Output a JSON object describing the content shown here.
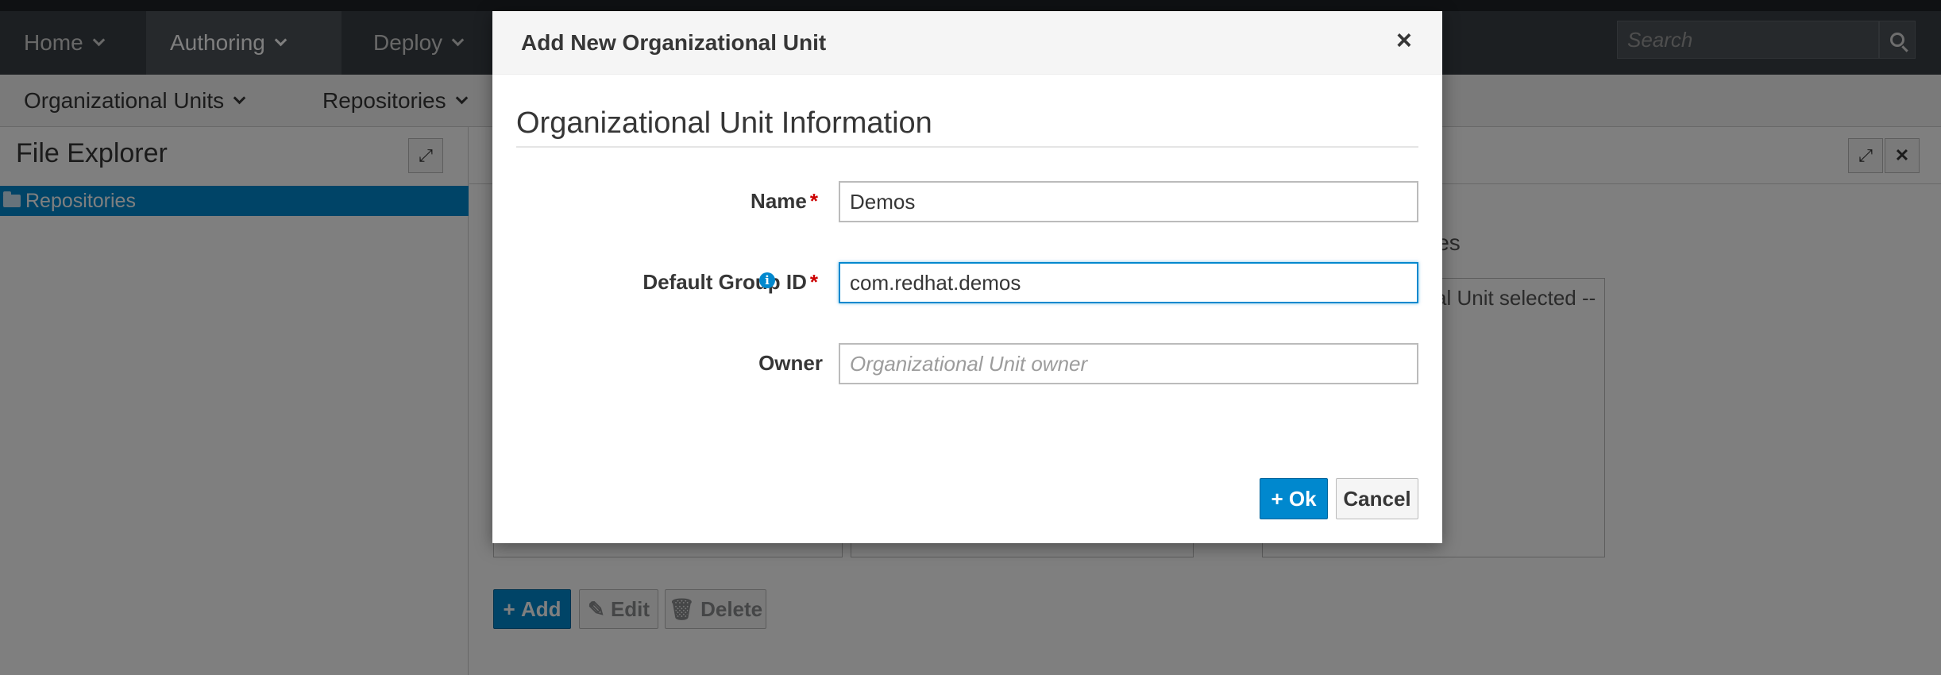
{
  "topnav": {
    "items": [
      {
        "label": "Home",
        "active": false
      },
      {
        "label": "Authoring",
        "active": true
      },
      {
        "label": "Deploy",
        "active": false
      }
    ],
    "search_placeholder": "Search"
  },
  "subnav": {
    "items": [
      {
        "label": "Organizational Units"
      },
      {
        "label": "Repositories"
      }
    ]
  },
  "explorer": {
    "title": "File Explorer",
    "tree_root": "Repositories"
  },
  "background": {
    "repositories_heading_fragment": "ies",
    "no_unit_text_fragment": "al Unit selected --",
    "add_label": "Add",
    "edit_label": "Edit",
    "delete_label": "Delete"
  },
  "modal": {
    "title": "Add New Organizational Unit",
    "close_glyph": "×",
    "section_title": "Organizational Unit Information",
    "fields": {
      "name": {
        "label": "Name",
        "required": "*",
        "value": "Demos",
        "placeholder": ""
      },
      "group_id": {
        "label": "Default Group ID",
        "required": "*",
        "value": "com.redhat.demos",
        "placeholder": ""
      },
      "owner": {
        "label": "Owner",
        "value": "",
        "placeholder": "Organizational Unit owner"
      }
    },
    "ok_label": "Ok",
    "cancel_label": "Cancel"
  },
  "colors": {
    "accent": "#0088ce",
    "nav_bg": "#393f44",
    "required": "#cc0000"
  }
}
